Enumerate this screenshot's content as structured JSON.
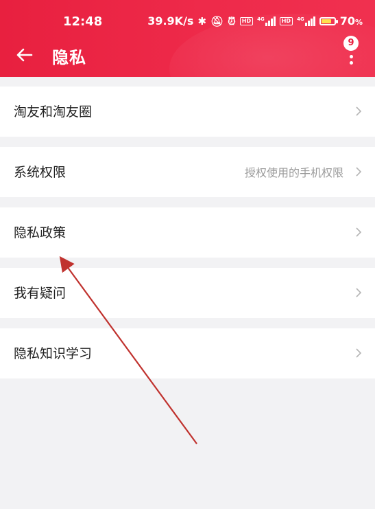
{
  "status_bar": {
    "time": "12:48",
    "speed": "39.9K/s",
    "net1": "4G",
    "net2": "4G",
    "hd": "HD",
    "battery": "70",
    "battery_unit": "%"
  },
  "header": {
    "title": "隐私",
    "badge_count": "9"
  },
  "items": [
    {
      "label": "淘友和淘友圈",
      "hint": ""
    },
    {
      "label": "系统权限",
      "hint": "授权使用的手机权限"
    },
    {
      "label": "隐私政策",
      "hint": ""
    },
    {
      "label": "我有疑问",
      "hint": ""
    },
    {
      "label": "隐私知识学习",
      "hint": ""
    }
  ],
  "colors": {
    "accent": "#e8203f",
    "page_bg": "#f2f2f4",
    "annotation_arrow": "#c0322e"
  }
}
